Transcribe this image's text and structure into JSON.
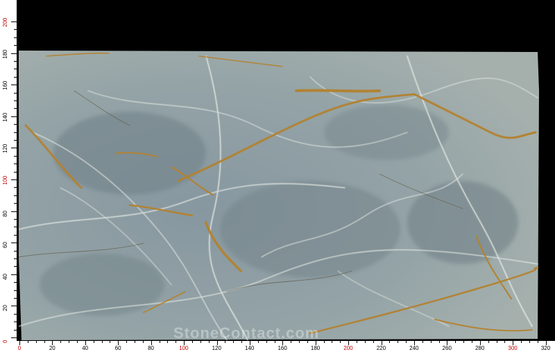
{
  "image": {
    "subject": "marble slab",
    "colors": {
      "base": "#8fa0a3",
      "dark": "#6e7f84",
      "vein_gold": "#b8862e",
      "vein_white": "#e8ece6",
      "background": "#000000"
    }
  },
  "rulers": {
    "left_labels": [
      "0",
      "20",
      "40",
      "60",
      "80",
      "100",
      "120",
      "140",
      "160",
      "180",
      "200"
    ],
    "bottom_labels": [
      "0",
      "20",
      "40",
      "60",
      "80",
      "100",
      "120",
      "140",
      "160",
      "180",
      "200",
      "220",
      "240",
      "260",
      "280",
      "300",
      "320"
    ],
    "major_labels": [
      "0",
      "100",
      "200",
      "300"
    ]
  },
  "watermark": "StoneContact.com"
}
